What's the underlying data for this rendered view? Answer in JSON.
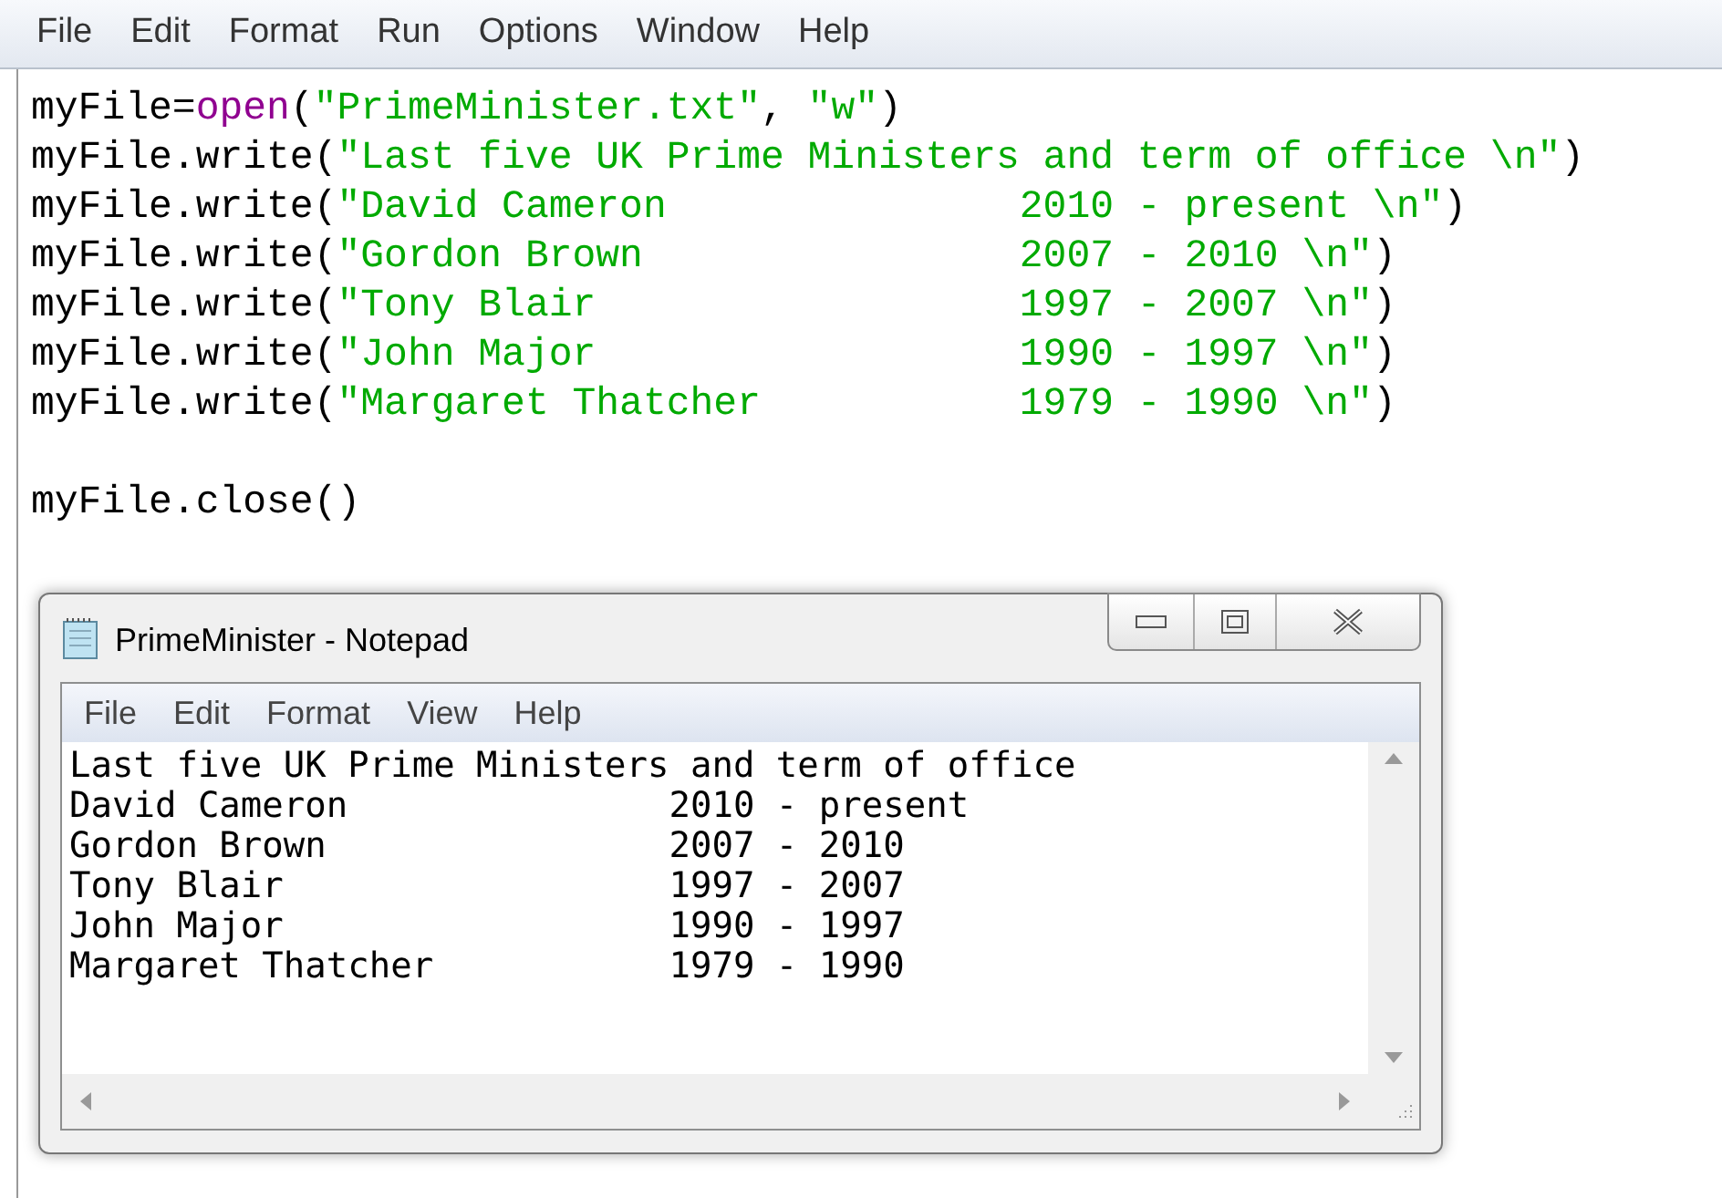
{
  "editor": {
    "menu": [
      "File",
      "Edit",
      "Format",
      "Run",
      "Options",
      "Window",
      "Help"
    ],
    "lines": [
      {
        "kind": "code",
        "tokens": [
          {
            "kind": "plain",
            "text": "myFile="
          },
          {
            "kind": "builtin",
            "text": "open"
          },
          {
            "kind": "plain",
            "text": "("
          },
          {
            "kind": "string",
            "text": "\"PrimeMinister.txt\""
          },
          {
            "kind": "plain",
            "text": ", "
          },
          {
            "kind": "string",
            "text": "\"w\""
          },
          {
            "kind": "plain",
            "text": ")"
          }
        ]
      },
      {
        "kind": "code",
        "tokens": [
          {
            "kind": "plain",
            "text": "myFile.write("
          },
          {
            "kind": "string",
            "text": "\"Last five UK Prime Ministers and term of office \\n\""
          },
          {
            "kind": "plain",
            "text": ")"
          }
        ]
      },
      {
        "kind": "code",
        "tokens": [
          {
            "kind": "plain",
            "text": "myFile.write("
          },
          {
            "kind": "string",
            "text": "\"David Cameron               2010 - present \\n\""
          },
          {
            "kind": "plain",
            "text": ")"
          }
        ]
      },
      {
        "kind": "code",
        "tokens": [
          {
            "kind": "plain",
            "text": "myFile.write("
          },
          {
            "kind": "string",
            "text": "\"Gordon Brown                2007 - 2010 \\n\""
          },
          {
            "kind": "plain",
            "text": ")"
          }
        ]
      },
      {
        "kind": "code",
        "tokens": [
          {
            "kind": "plain",
            "text": "myFile.write("
          },
          {
            "kind": "string",
            "text": "\"Tony Blair                  1997 - 2007 \\n\""
          },
          {
            "kind": "plain",
            "text": ")"
          }
        ]
      },
      {
        "kind": "code",
        "tokens": [
          {
            "kind": "plain",
            "text": "myFile.write("
          },
          {
            "kind": "string",
            "text": "\"John Major                  1990 - 1997 \\n\""
          },
          {
            "kind": "plain",
            "text": ")"
          }
        ]
      },
      {
        "kind": "code",
        "tokens": [
          {
            "kind": "plain",
            "text": "myFile.write("
          },
          {
            "kind": "string",
            "text": "\"Margaret Thatcher           1979 - 1990 \\n\""
          },
          {
            "kind": "plain",
            "text": ")"
          }
        ]
      },
      {
        "kind": "blank"
      },
      {
        "kind": "code",
        "tokens": [
          {
            "kind": "plain",
            "text": "myFile.close()"
          }
        ]
      }
    ]
  },
  "notepad": {
    "title": "PrimeMinister - Notepad",
    "menu": [
      "File",
      "Edit",
      "Format",
      "View",
      "Help"
    ],
    "lines": [
      "Last five UK Prime Ministers and term of office",
      "David Cameron               2010 - present",
      "Gordon Brown                2007 - 2010",
      "Tony Blair                  1997 - 2007",
      "John Major                  1990 - 1997",
      "Margaret Thatcher           1979 - 1990"
    ]
  }
}
